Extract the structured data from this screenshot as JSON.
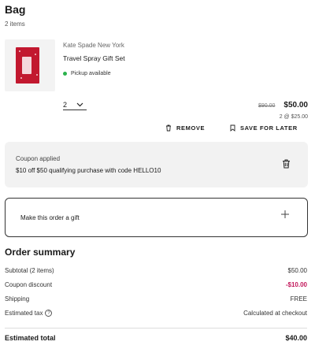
{
  "bag": {
    "title": "Bag",
    "item_count": "2 items"
  },
  "item": {
    "brand": "Kate Spade New York",
    "name": "Travel Spray Gift Set",
    "pickup": "Pickup available",
    "quantity": "2",
    "original_price": "$90.00",
    "price": "$50.00",
    "unit_price": "2 @ $25.00",
    "remove_label": "REMOVE",
    "save_label": "SAVE FOR LATER"
  },
  "coupon": {
    "status": "Coupon applied",
    "detail": "$10 off $50 qualifying purchase with code HELLO10"
  },
  "gift": {
    "label": "Make this order a gift"
  },
  "summary": {
    "title": "Order summary",
    "subtotal_label": "Subtotal (2 items)",
    "subtotal_value": "$50.00",
    "coupon_label": "Coupon discount",
    "coupon_value": "-$10.00",
    "shipping_label": "Shipping",
    "shipping_value": "FREE",
    "tax_label": "Estimated tax",
    "tax_value": "Calculated at checkout",
    "total_label": "Estimated total",
    "total_value": "$40.00"
  },
  "colors": {
    "discount": "#c2185b",
    "pickup_dot": "#2bb24c",
    "product_box": "#c2182f"
  },
  "icons": [
    "chevron-down-icon",
    "trash-icon",
    "bookmark-icon",
    "info-icon",
    "plus-icon"
  ]
}
